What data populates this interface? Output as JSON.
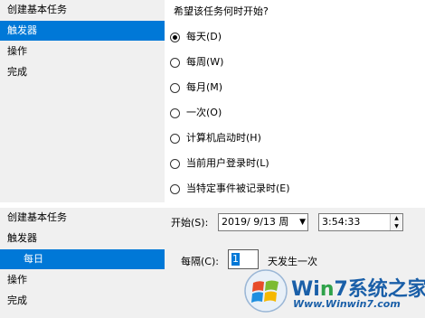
{
  "top_panel": {
    "sidebar": {
      "items": [
        {
          "label": "创建基本任务"
        },
        {
          "label": "触发器"
        },
        {
          "label": "操作"
        },
        {
          "label": "完成"
        }
      ]
    },
    "question": "希望该任务何时开始?",
    "radios": [
      {
        "label": "每天(D)",
        "checked": true
      },
      {
        "label": "每周(W)",
        "checked": false
      },
      {
        "label": "每月(M)",
        "checked": false
      },
      {
        "label": "一次(O)",
        "checked": false
      },
      {
        "label": "计算机启动时(H)",
        "checked": false
      },
      {
        "label": "当前用户登录时(L)",
        "checked": false
      },
      {
        "label": "当特定事件被记录时(E)",
        "checked": false
      }
    ]
  },
  "bottom_panel": {
    "sidebar": {
      "items": [
        {
          "label": "创建基本任务"
        },
        {
          "label": "触发器"
        },
        {
          "label": "每日"
        },
        {
          "label": "操作"
        },
        {
          "label": "完成"
        }
      ]
    },
    "start_label": "开始(S):",
    "date_value": "2019/  9/13 周",
    "time_value": "3:54:33",
    "repeat_label": "每隔(C):",
    "repeat_value": "1",
    "repeat_suffix": "天发生一次"
  },
  "watermark": {
    "brand_prefix": "Wi",
    "brand_n": "n",
    "brand_digit": "7",
    "brand_suffix": "系统之家",
    "url": "Www.Winwin7.com"
  },
  "colors": {
    "selection": "#0078d7",
    "panel": "#f0f0f0",
    "watermark_blue": "#1a5fa8",
    "watermark_green": "#2fa24a"
  }
}
